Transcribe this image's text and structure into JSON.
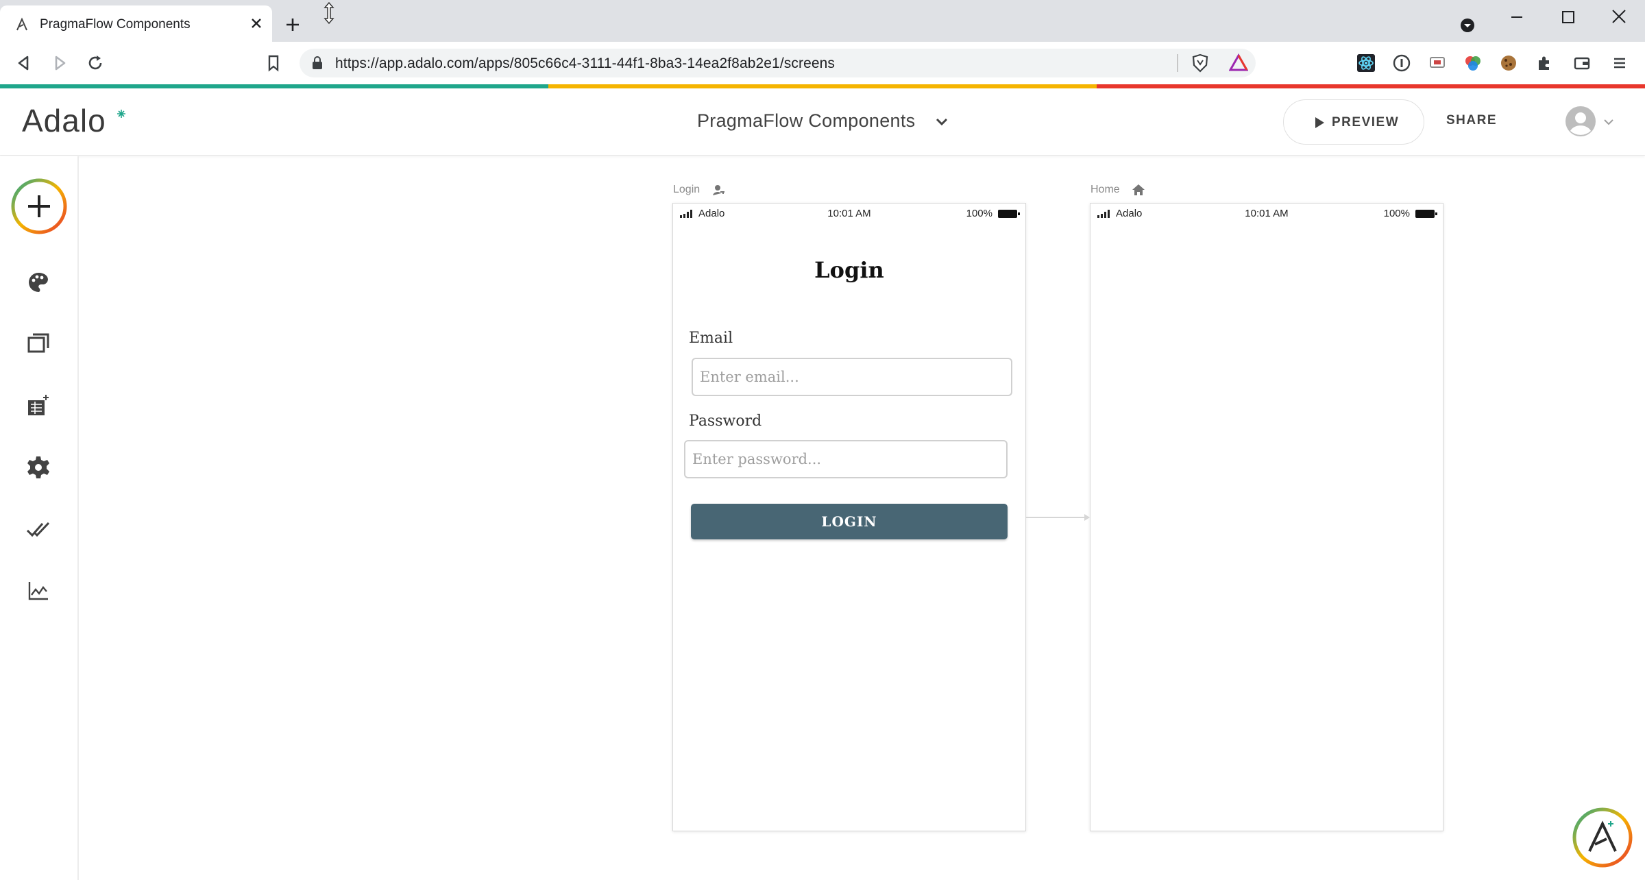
{
  "browser": {
    "tab_title": "PragmaFlow Components",
    "url": "https://app.adalo.com/apps/805c66c4-3111-44f1-8ba3-14ea2f8ab2e1/screens",
    "stripe_colors": [
      "#1fa68b",
      "#f5b400",
      "#e8372c"
    ]
  },
  "header": {
    "logo": "Adalo",
    "app_name": "PragmaFlow Components",
    "preview_label": "PREVIEW",
    "share_label": "SHARE"
  },
  "sidebar": {
    "items": [
      {
        "icon": "plus-icon",
        "name": "add-component"
      },
      {
        "icon": "palette-icon",
        "name": "branding"
      },
      {
        "icon": "screens-icon",
        "name": "screens"
      },
      {
        "icon": "database-icon",
        "name": "database"
      },
      {
        "icon": "gear-icon",
        "name": "settings"
      },
      {
        "icon": "double-check-icon",
        "name": "publish"
      },
      {
        "icon": "analytics-icon",
        "name": "analytics"
      }
    ]
  },
  "screens": [
    {
      "label": "Login",
      "label_icon": "user-key-icon",
      "status": {
        "carrier": "Adalo",
        "time": "10:01 AM",
        "battery": "100%"
      },
      "heading": "Login",
      "email_label": "Email",
      "email_placeholder": "Enter email...",
      "password_label": "Password",
      "password_placeholder": "Enter password...",
      "button_label": "LOGIN"
    },
    {
      "label": "Home",
      "label_icon": "home-icon",
      "status": {
        "carrier": "Adalo",
        "time": "10:01 AM",
        "battery": "100%"
      }
    }
  ],
  "colors": {
    "login_button": "#486674",
    "accent_teal": "#1fa68b",
    "accent_yellow": "#f5b400",
    "accent_red": "#e8372c"
  }
}
